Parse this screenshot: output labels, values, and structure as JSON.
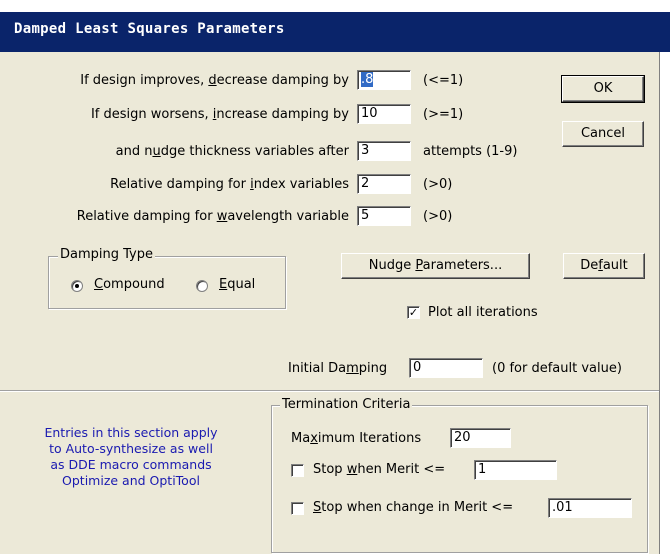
{
  "window": {
    "title": "Damped Least Squares Parameters"
  },
  "fields": [
    {
      "label_pre": "If design improves, ",
      "label_u": "d",
      "label_post": "ecrease damping by",
      "value": ".8",
      "hint": "(<=1)"
    },
    {
      "label_pre": "If design worsens, ",
      "label_u": "i",
      "label_post": "ncrease damping by",
      "value": "10",
      "hint": "(>=1)"
    },
    {
      "label_pre": "and n",
      "label_u": "u",
      "label_post": "dge thickness variables after",
      "value": "3",
      "hint": "attempts (1-9)"
    },
    {
      "label_pre": "Relative damping for ",
      "label_u": "i",
      "label_post": "ndex variables",
      "value": "2",
      "hint": "(>0)"
    },
    {
      "label_pre": "Relative damping for ",
      "label_u": "w",
      "label_post": "avelength variable",
      "value": "5",
      "hint": "(>0)"
    }
  ],
  "buttons": {
    "ok": "OK",
    "cancel": "Cancel",
    "nudge_pre": "Nudge ",
    "nudge_u": "P",
    "nudge_post": "arameters...",
    "default_pre": "De",
    "default_u": "f",
    "default_post": "ault"
  },
  "damping_type": {
    "title": "Damping Type",
    "compound_u": "C",
    "compound_post": "ompound",
    "equal_u": "E",
    "equal_post": "qual",
    "selected": "Compound"
  },
  "plot_all": {
    "label": "Plot all iterations",
    "checked": true
  },
  "initial_damping": {
    "label_pre": "Initial Da",
    "label_u": "m",
    "label_post": "ping",
    "value": "0",
    "hint": "(0 for default value)"
  },
  "termination": {
    "title": "Termination Criteria",
    "max_iter_pre": "Ma",
    "max_iter_u": "x",
    "max_iter_post": "imum Iterations",
    "max_iter_value": "20",
    "stop_merit_pre": "Stop ",
    "stop_merit_u": "w",
    "stop_merit_post": "hen Merit <=",
    "stop_merit_value": "1",
    "stop_merit_checked": false,
    "stop_change_u": "S",
    "stop_change_post": "top when change in Merit <=",
    "stop_change_value": ".01",
    "stop_change_checked": false
  },
  "info_lines": [
    "Entries in this section apply",
    "to Auto-synthesize as well",
    "as DDE macro commands",
    "Optimize and OptiTool"
  ],
  "colors": {
    "titlebar": "#0a246a",
    "dialog": "#ece9d8",
    "info_text": "#1a1ab0",
    "selection": "#316ac5"
  }
}
